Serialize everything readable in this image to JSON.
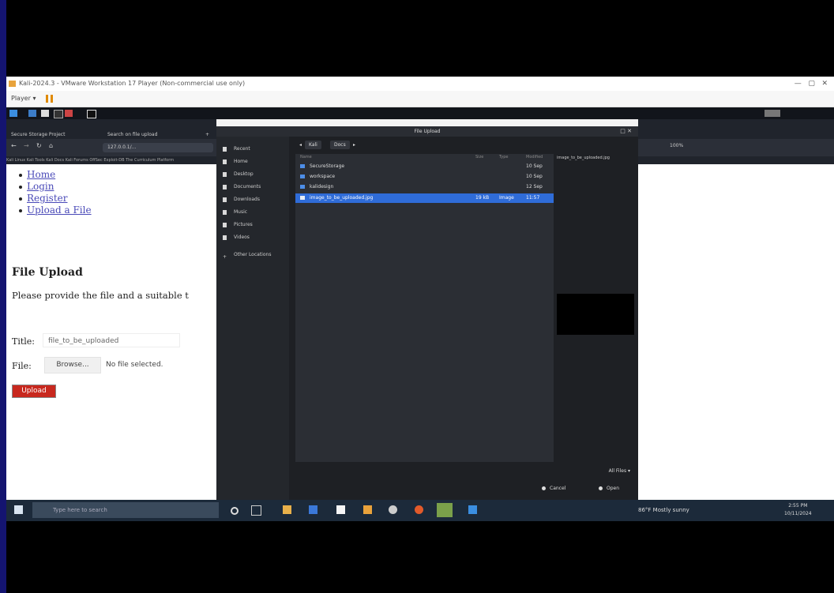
{
  "vmware": {
    "title": "Kali-2024.3 - VMware Workstation 17 Player (Non-commercial use only)",
    "player_menu": "Player ▾"
  },
  "browser": {
    "tabs": [
      "Secure Storage Project",
      "Search on file upload"
    ],
    "url": "127.0.0.1/...",
    "bookmarks": "Kali Linux   Kali Tools   Kali Docs   Kali Forums   OffSec   Exploit-DB   The Curriculum Platform",
    "zoom": "100%"
  },
  "page": {
    "nav": [
      "Home",
      "Login",
      "Register",
      "Upload a File"
    ],
    "heading": "File Upload",
    "description": "Please provide the file and a suitable t",
    "title_label": "Title:",
    "title_value": "file_to_be_uploaded",
    "file_label": "File:",
    "browse_label": "Browse...",
    "no_file": "No file selected.",
    "upload_label": "Upload"
  },
  "dialog": {
    "title": "File Upload",
    "places": [
      "Recent",
      "Home",
      "Desktop",
      "Documents",
      "Downloads",
      "Music",
      "Pictures",
      "Videos",
      "Other Locations"
    ],
    "path": [
      "Kali",
      "Docs"
    ],
    "columns": {
      "name": "Name",
      "size": "Size",
      "type": "Type",
      "modified": "Modified"
    },
    "files": [
      {
        "name": "SecureStorage",
        "size": "",
        "type": "",
        "modified": "10 Sep"
      },
      {
        "name": "workspace",
        "size": "",
        "type": "",
        "modified": "10 Sep"
      },
      {
        "name": "kalidesign",
        "size": "",
        "type": "",
        "modified": "12 Sep"
      },
      {
        "name": "image_to_be_uploaded.jpg",
        "size": "19 kB",
        "type": "Image",
        "modified": "11:57",
        "selected": true
      }
    ],
    "preview_name": "image_to_be_uploaded.jpg",
    "filter": "All Files ▾",
    "cancel_label": "Cancel",
    "open_label": "Open"
  },
  "taskbar": {
    "search_placeholder": "Type here to search",
    "weather": "86°F  Mostly sunny",
    "time": "2:55 PM",
    "date": "10/11/2024"
  },
  "colors": {
    "accent": "#2f6cd8",
    "upload_button": "#c8281e",
    "frame": "#141470"
  }
}
